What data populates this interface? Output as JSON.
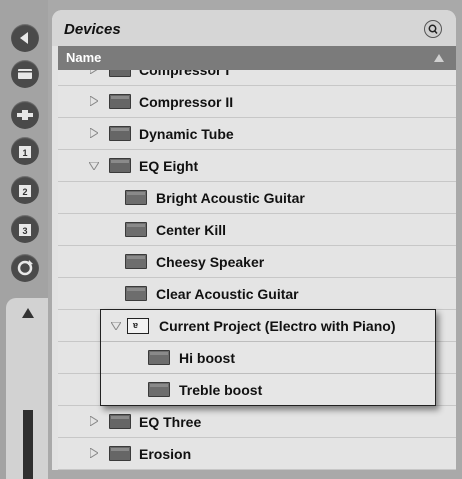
{
  "browser": {
    "title": "Devices",
    "column_header": "Name"
  },
  "sidebar": {
    "buttons": [
      "back-icon",
      "devices-icon",
      "plugin-icon",
      "folder-1-icon",
      "folder-2-icon",
      "folder-3-icon",
      "sync-icon"
    ],
    "folder_labels": [
      "1",
      "2",
      "3"
    ]
  },
  "rows": [
    {
      "label": "Compressor I",
      "expanded": false
    },
    {
      "label": "Compressor II",
      "expanded": false
    },
    {
      "label": "Dynamic Tube",
      "expanded": false
    },
    {
      "label": "EQ Eight",
      "expanded": true
    },
    {
      "label": "Bright Acoustic Guitar"
    },
    {
      "label": "Center Kill"
    },
    {
      "label": "Cheesy Speaker"
    },
    {
      "label": "Clear Acoustic Guitar"
    },
    {
      "label": ""
    },
    {
      "label": ""
    },
    {
      "label": ""
    },
    {
      "label": "EQ Three",
      "expanded": false
    },
    {
      "label": "Erosion",
      "expanded": false
    }
  ],
  "popup": {
    "project_label": "Current Project (Electro with Piano)",
    "items": [
      "Hi boost",
      "Treble boost"
    ]
  }
}
